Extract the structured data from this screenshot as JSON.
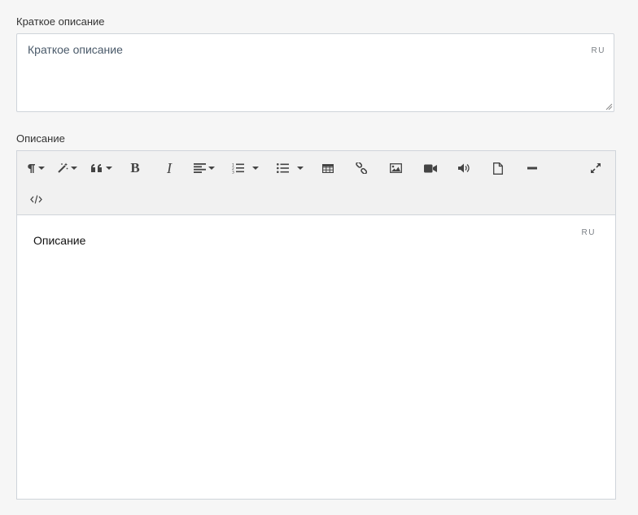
{
  "short_description": {
    "label": "Краткое описание",
    "value": "Краткое описание",
    "lang": "RU"
  },
  "description": {
    "label": "Описание",
    "value": "Описание",
    "lang": "RU"
  },
  "toolbar": {
    "icons": [
      "paragraph-icon",
      "magic-wand-icon",
      "quote-icon",
      "bold-icon",
      "italic-icon",
      "align-left-icon",
      "ordered-list-icon",
      "unordered-list-icon",
      "table-icon",
      "link-icon",
      "image-icon",
      "video-icon",
      "audio-icon",
      "file-icon",
      "horizontal-rule-icon",
      "fullscreen-icon",
      "code-view-icon"
    ],
    "bold_glyph": "B",
    "italic_glyph": "I"
  }
}
